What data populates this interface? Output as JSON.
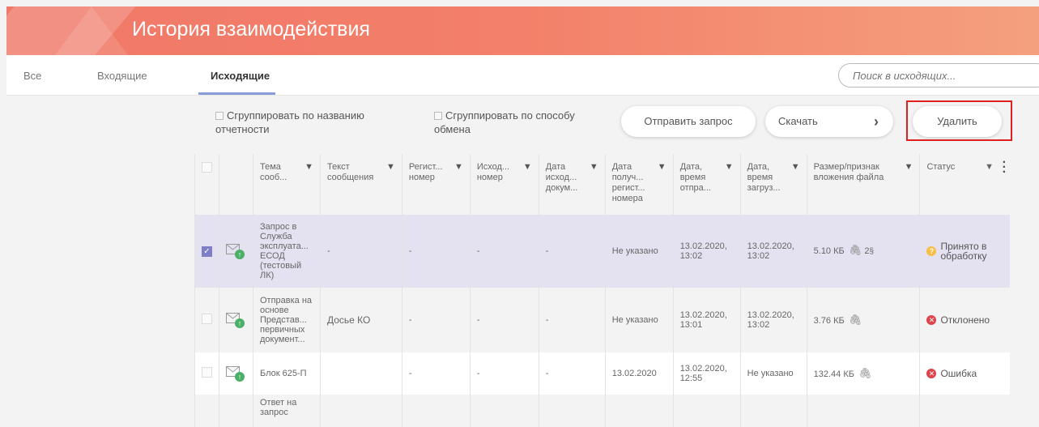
{
  "page": {
    "title": "История взаимодействия"
  },
  "tabs": [
    {
      "label": "Все"
    },
    {
      "label": "Входящие"
    },
    {
      "label": "Исходящие",
      "active": true
    }
  ],
  "search": {
    "placeholder": "Поиск в исходящих..."
  },
  "toolbar": {
    "group_by_name": "Сгруппировать по названию отчетности",
    "group_by_exchange": "Сгруппировать по способу обмена",
    "send_request": "Отправить запрос",
    "download": "Скачать",
    "download_arrow": "›",
    "delete": "Удалить"
  },
  "table": {
    "headers": {
      "subject": "Тема сооб...",
      "text": "Текст сообщения",
      "reg": "Регист... номер",
      "out": "Исход... номер",
      "outdate": "Дата исход... докум...",
      "recvdate": "Дата получ... регист... номера",
      "sent": "Дата, время отпра...",
      "loaded": "Дата, время загруз...",
      "size": "Размер/признак вложения файла",
      "status": "Статус"
    },
    "rows": [
      {
        "checked": true,
        "subject": "Запрос в Служба эксплуата... ЕСОД (тестовый ЛК)",
        "text": "-",
        "reg": "-",
        "out": "-",
        "outdate": "-",
        "recvdate": "Не указано",
        "sent": "13.02.2020, 13:02",
        "loaded": "13.02.2020, 13:02",
        "size": "5.10 КБ",
        "extra": "2",
        "status": "Принято в обработку",
        "status_type": "pending"
      },
      {
        "checked": false,
        "subject": "Отправка на основе Представ... первичных документ...",
        "text": "Досье КО",
        "reg": "-",
        "out": "-",
        "outdate": "-",
        "recvdate": "Не указано",
        "sent": "13.02.2020, 13:01",
        "loaded": "13.02.2020, 13:02",
        "size": "3.76 КБ",
        "extra": "",
        "status": "Отклонено",
        "status_type": "error"
      },
      {
        "checked": false,
        "subject": "Блок 625-П",
        "text": "",
        "reg": "-",
        "out": "-",
        "outdate": "-",
        "recvdate": "13.02.2020",
        "sent": "13.02.2020, 12:55",
        "loaded": "Не указано",
        "size": "132.44 КБ",
        "extra": "",
        "status": "Ошибка",
        "status_type": "error"
      },
      {
        "checked": false,
        "subject": "Ответ на запрос",
        "text": "",
        "reg": "",
        "out": "",
        "outdate": "",
        "recvdate": "",
        "sent": "",
        "loaded": "",
        "size": "",
        "extra": "",
        "status": "",
        "status_type": ""
      }
    ]
  },
  "colors": {
    "banner_start": "#f07868",
    "banner_end": "#f4a07e",
    "selected_row": "#e4e2f1",
    "highlight": "#e02020"
  }
}
